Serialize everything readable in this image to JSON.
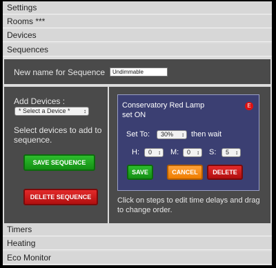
{
  "menu": {
    "settings": "Settings",
    "rooms": "Rooms ***",
    "devices": "Devices",
    "sequences": "Sequences",
    "timers": "Timers",
    "heating": "Heating",
    "eco_monitor": "Eco Monitor"
  },
  "sequence": {
    "name_label": "New name for Sequence",
    "name_value": "Undimmable"
  },
  "left": {
    "add_devices_label": "Add Devices :",
    "device_select": "* Select a Device *",
    "help_text": "Select devices to add to sequence.",
    "save_sequence": "SAVE SEQUENCE",
    "delete_sequence": "DELETE SEQUENCE"
  },
  "step": {
    "title_line1": "Conservatory Red Lamp",
    "title_line2": "set ON",
    "edit_badge": "E",
    "set_to_label": "Set To:",
    "set_to_value": "30%",
    "then_wait": "then wait",
    "h_label": "H:",
    "h_value": "0",
    "m_label": "M:",
    "m_value": "0",
    "s_label": "S:",
    "s_value": "5",
    "save": "SAVE",
    "cancel": "CANCEL",
    "delete": "DELETE"
  },
  "right": {
    "instructions": "Click on steps to edit time delays and drag to change order."
  },
  "colors": {
    "panel": "#4a4a4a",
    "card": "#3b3f72",
    "green": "#1ea81e",
    "red": "#d11a1a",
    "orange": "#ff9020"
  }
}
